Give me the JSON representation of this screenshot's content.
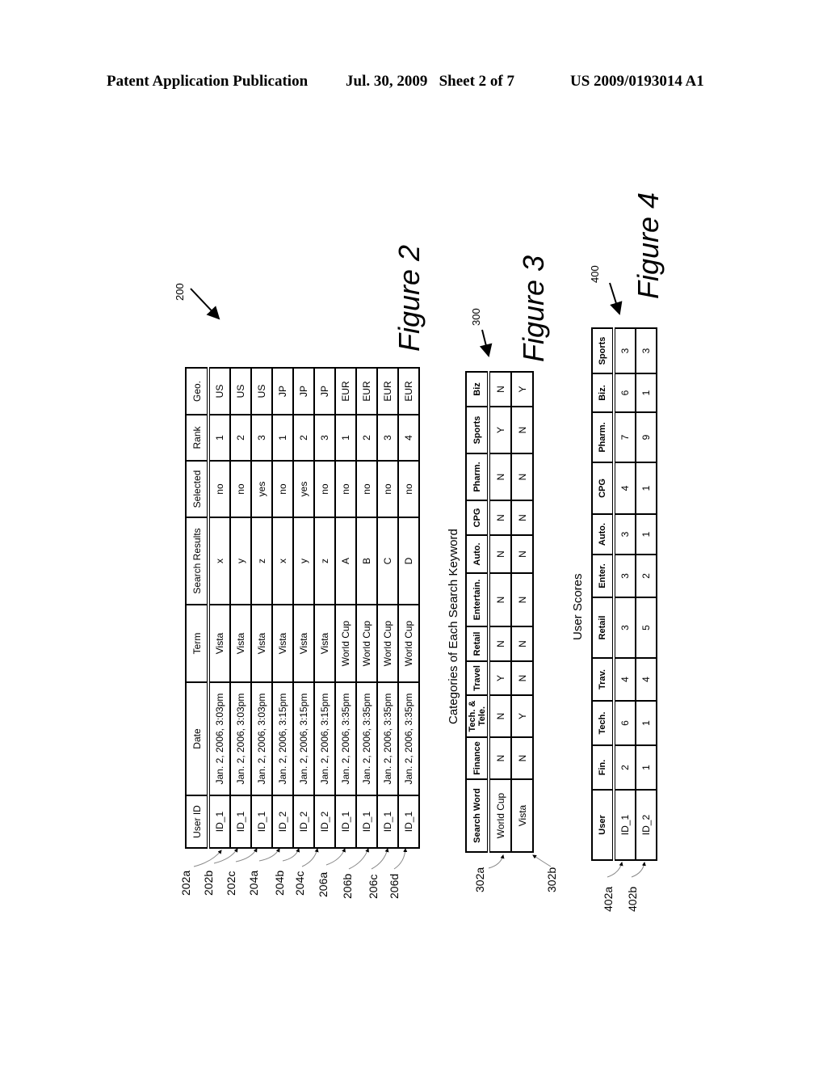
{
  "header": {
    "publication": "Patent Application Publication",
    "date_sheet": "Jul. 30, 2009   Sheet 2 of 7",
    "number": "US 2009/0193014 A1"
  },
  "figure2": {
    "ref": "200",
    "title": "Figure 2",
    "columns": [
      "User ID",
      "Date",
      "Term",
      "Search Results",
      "Selected",
      "Rank",
      "Geo."
    ],
    "rows": [
      {
        "ref": "202a",
        "cells": [
          "ID_1",
          "Jan. 2, 2006, 3:03pm",
          "Vista",
          "x",
          "no",
          "1",
          "US"
        ]
      },
      {
        "ref": "202b",
        "cells": [
          "ID_1",
          "Jan. 2, 2006, 3:03pm",
          "Vista",
          "y",
          "no",
          "2",
          "US"
        ]
      },
      {
        "ref": "202c",
        "cells": [
          "ID_1",
          "Jan. 2, 2006, 3:03pm",
          "Vista",
          "z",
          "yes",
          "3",
          "US"
        ]
      },
      {
        "ref": "204a",
        "cells": [
          "ID_2",
          "Jan. 2, 2006, 3:15pm",
          "Vista",
          "x",
          "no",
          "1",
          "JP"
        ]
      },
      {
        "ref": "204b",
        "cells": [
          "ID_2",
          "Jan. 2, 2006, 3:15pm",
          "Vista",
          "y",
          "yes",
          "2",
          "JP"
        ]
      },
      {
        "ref": "204c",
        "cells": [
          "ID_2",
          "Jan. 2, 2006, 3:15pm",
          "Vista",
          "z",
          "no",
          "3",
          "JP"
        ]
      },
      {
        "ref": "206a",
        "cells": [
          "ID_1",
          "Jan. 2, 2006, 3:35pm",
          "World Cup",
          "A",
          "no",
          "1",
          "EUR"
        ]
      },
      {
        "ref": "206b",
        "cells": [
          "ID_1",
          "Jan. 2, 2006, 3:35pm",
          "World Cup",
          "B",
          "no",
          "2",
          "EUR"
        ]
      },
      {
        "ref": "206c",
        "cells": [
          "ID_1",
          "Jan. 2, 2006, 3:35pm",
          "World Cup",
          "C",
          "no",
          "3",
          "EUR"
        ]
      },
      {
        "ref": "206d",
        "cells": [
          "ID_1",
          "Jan. 2, 2006, 3:35pm",
          "World Cup",
          "D",
          "no",
          "4",
          "EUR"
        ]
      }
    ]
  },
  "figure3": {
    "ref": "300",
    "title": "Figure 3",
    "caption": "Categories of Each Search Keyword",
    "columns": [
      "Search Word",
      "Finance",
      "Tech. & Tele.",
      "Travel",
      "Retail",
      "Entertain.",
      "Auto.",
      "CPG",
      "Pharm.",
      "Sports",
      "Biz"
    ],
    "rows": [
      {
        "ref": "302a",
        "cells": [
          "World Cup",
          "N",
          "N",
          "Y",
          "N",
          "N",
          "N",
          "N",
          "N",
          "Y",
          "N"
        ]
      },
      {
        "ref": "302b",
        "cells": [
          "Vista",
          "N",
          "Y",
          "N",
          "N",
          "N",
          "N",
          "N",
          "N",
          "N",
          "Y"
        ]
      }
    ]
  },
  "figure4": {
    "ref": "400",
    "title": "Figure 4",
    "caption": "User Scores",
    "columns": [
      "User",
      "Fin.",
      "Tech.",
      "Trav.",
      "Retail",
      "Enter.",
      "Auto.",
      "CPG",
      "Pharm.",
      "Biz.",
      "Sports"
    ],
    "rows": [
      {
        "ref": "402a",
        "cells": [
          "ID_1",
          "2",
          "6",
          "4",
          "3",
          "3",
          "3",
          "4",
          "7",
          "6",
          "3"
        ]
      },
      {
        "ref": "402b",
        "cells": [
          "ID_2",
          "1",
          "1",
          "4",
          "5",
          "2",
          "1",
          "1",
          "9",
          "1",
          "3"
        ]
      }
    ]
  }
}
